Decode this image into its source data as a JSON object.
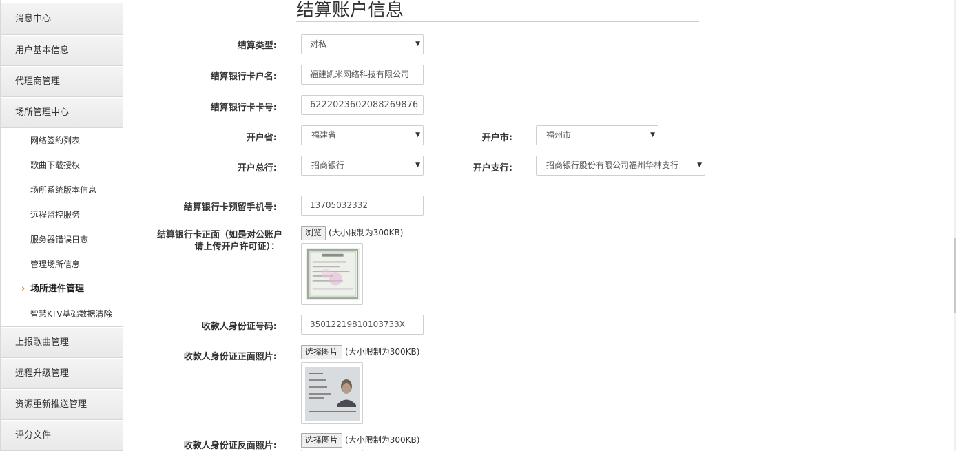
{
  "sidebar": {
    "group_top": [
      {
        "label": "消息中心"
      },
      {
        "label": "用户基本信息"
      },
      {
        "label": "代理商管理"
      },
      {
        "label": "场所管理中心"
      }
    ],
    "sub_items": [
      {
        "label": "网络签约列表"
      },
      {
        "label": "歌曲下载授权"
      },
      {
        "label": "场所系统版本信息"
      },
      {
        "label": "远程监控服务"
      },
      {
        "label": "服务器错误日志"
      },
      {
        "label": "管理场所信息"
      },
      {
        "label": "场所进件管理",
        "active": true
      },
      {
        "label": "智慧KTV基础数据清除"
      }
    ],
    "group_bottom": [
      {
        "label": "上报歌曲管理"
      },
      {
        "label": "远程升级管理"
      },
      {
        "label": "资源重新推送管理"
      },
      {
        "label": "评分文件"
      }
    ],
    "active_arrow": "›"
  },
  "page": {
    "title": "结算账户信息"
  },
  "form": {
    "settle_type": {
      "label": "结算类型:",
      "value": "对私"
    },
    "account_name": {
      "label": "结算银行卡户名:",
      "value": "福建凯米网络科技有限公司"
    },
    "card_no": {
      "label": "结算银行卡卡号:",
      "value": "6222023602088269876"
    },
    "province": {
      "label": "开户省:",
      "value": "福建省"
    },
    "city": {
      "label": "开户市:",
      "value": "福州市"
    },
    "bank": {
      "label": "开户总行:",
      "value": "招商银行"
    },
    "branch": {
      "label": "开户支行:",
      "value": "招商银行股份有限公司福州华林支行"
    },
    "phone": {
      "label": "结算银行卡预留手机号:",
      "value": "13705032332"
    },
    "card_front": {
      "label_line1": "结算银行卡正面（如是对公账户",
      "label_line2": "请上传开户许可证）：",
      "button": "浏览",
      "hint": "(大小限制为300KB)"
    },
    "id_no": {
      "label": "收款人身份证号码:",
      "value": "35012219810103733X"
    },
    "id_front": {
      "label": "收款人身份证正面照片:",
      "button": "选择图片",
      "hint": "(大小限制为300KB)"
    },
    "id_back": {
      "label": "收款人身份证反面照片:",
      "button": "选择图片",
      "hint": "(大小限制为300KB)"
    }
  },
  "icons": {
    "caret": "▼"
  }
}
